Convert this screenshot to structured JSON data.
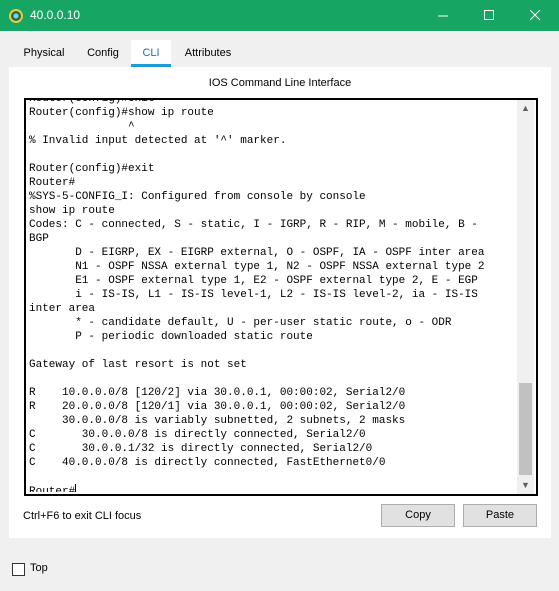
{
  "window": {
    "title": "40.0.0.10",
    "titlebar_color": "#17a563",
    "icon": "network-device-icon",
    "controls": [
      "minimize-icon",
      "maximize-icon",
      "close-icon"
    ]
  },
  "tabs": [
    {
      "label": "Physical"
    },
    {
      "label": "Config"
    },
    {
      "label": "CLI",
      "active": true
    },
    {
      "label": "Attributes"
    }
  ],
  "cli": {
    "caption": "IOS Command Line Interface",
    "terminal_text": "Router(config)#exit\nRouter(config)#show ip route\n               ^\n% Invalid input detected at '^' marker.\n\nRouter(config)#exit\nRouter#\n%SYS-5-CONFIG_I: Configured from console by console\nshow ip route\nCodes: C - connected, S - static, I - IGRP, R - RIP, M - mobile, B -\nBGP\n       D - EIGRP, EX - EIGRP external, O - OSPF, IA - OSPF inter area\n       N1 - OSPF NSSA external type 1, N2 - OSPF NSSA external type 2\n       E1 - OSPF external type 1, E2 - OSPF external type 2, E - EGP\n       i - IS-IS, L1 - IS-IS level-1, L2 - IS-IS level-2, ia - IS-IS\ninter area\n       * - candidate default, U - per-user static route, o - ODR\n       P - periodic downloaded static route\n\nGateway of last resort is not set\n\nR    10.0.0.0/8 [120/2] via 30.0.0.1, 00:00:02, Serial2/0\nR    20.0.0.0/8 [120/1] via 30.0.0.1, 00:00:02, Serial2/0\n     30.0.0.0/8 is variably subnetted, 2 subnets, 2 masks\nC       30.0.0.0/8 is directly connected, Serial2/0\nC       30.0.0.1/32 is directly connected, Serial2/0\nC    40.0.0.0/8 is directly connected, FastEthernet0/0\n\nRouter#",
    "hint": "Ctrl+F6 to exit CLI focus",
    "copy_label": "Copy",
    "paste_label": "Paste"
  },
  "footer": {
    "top_label": "Top",
    "top_checked": false
  }
}
